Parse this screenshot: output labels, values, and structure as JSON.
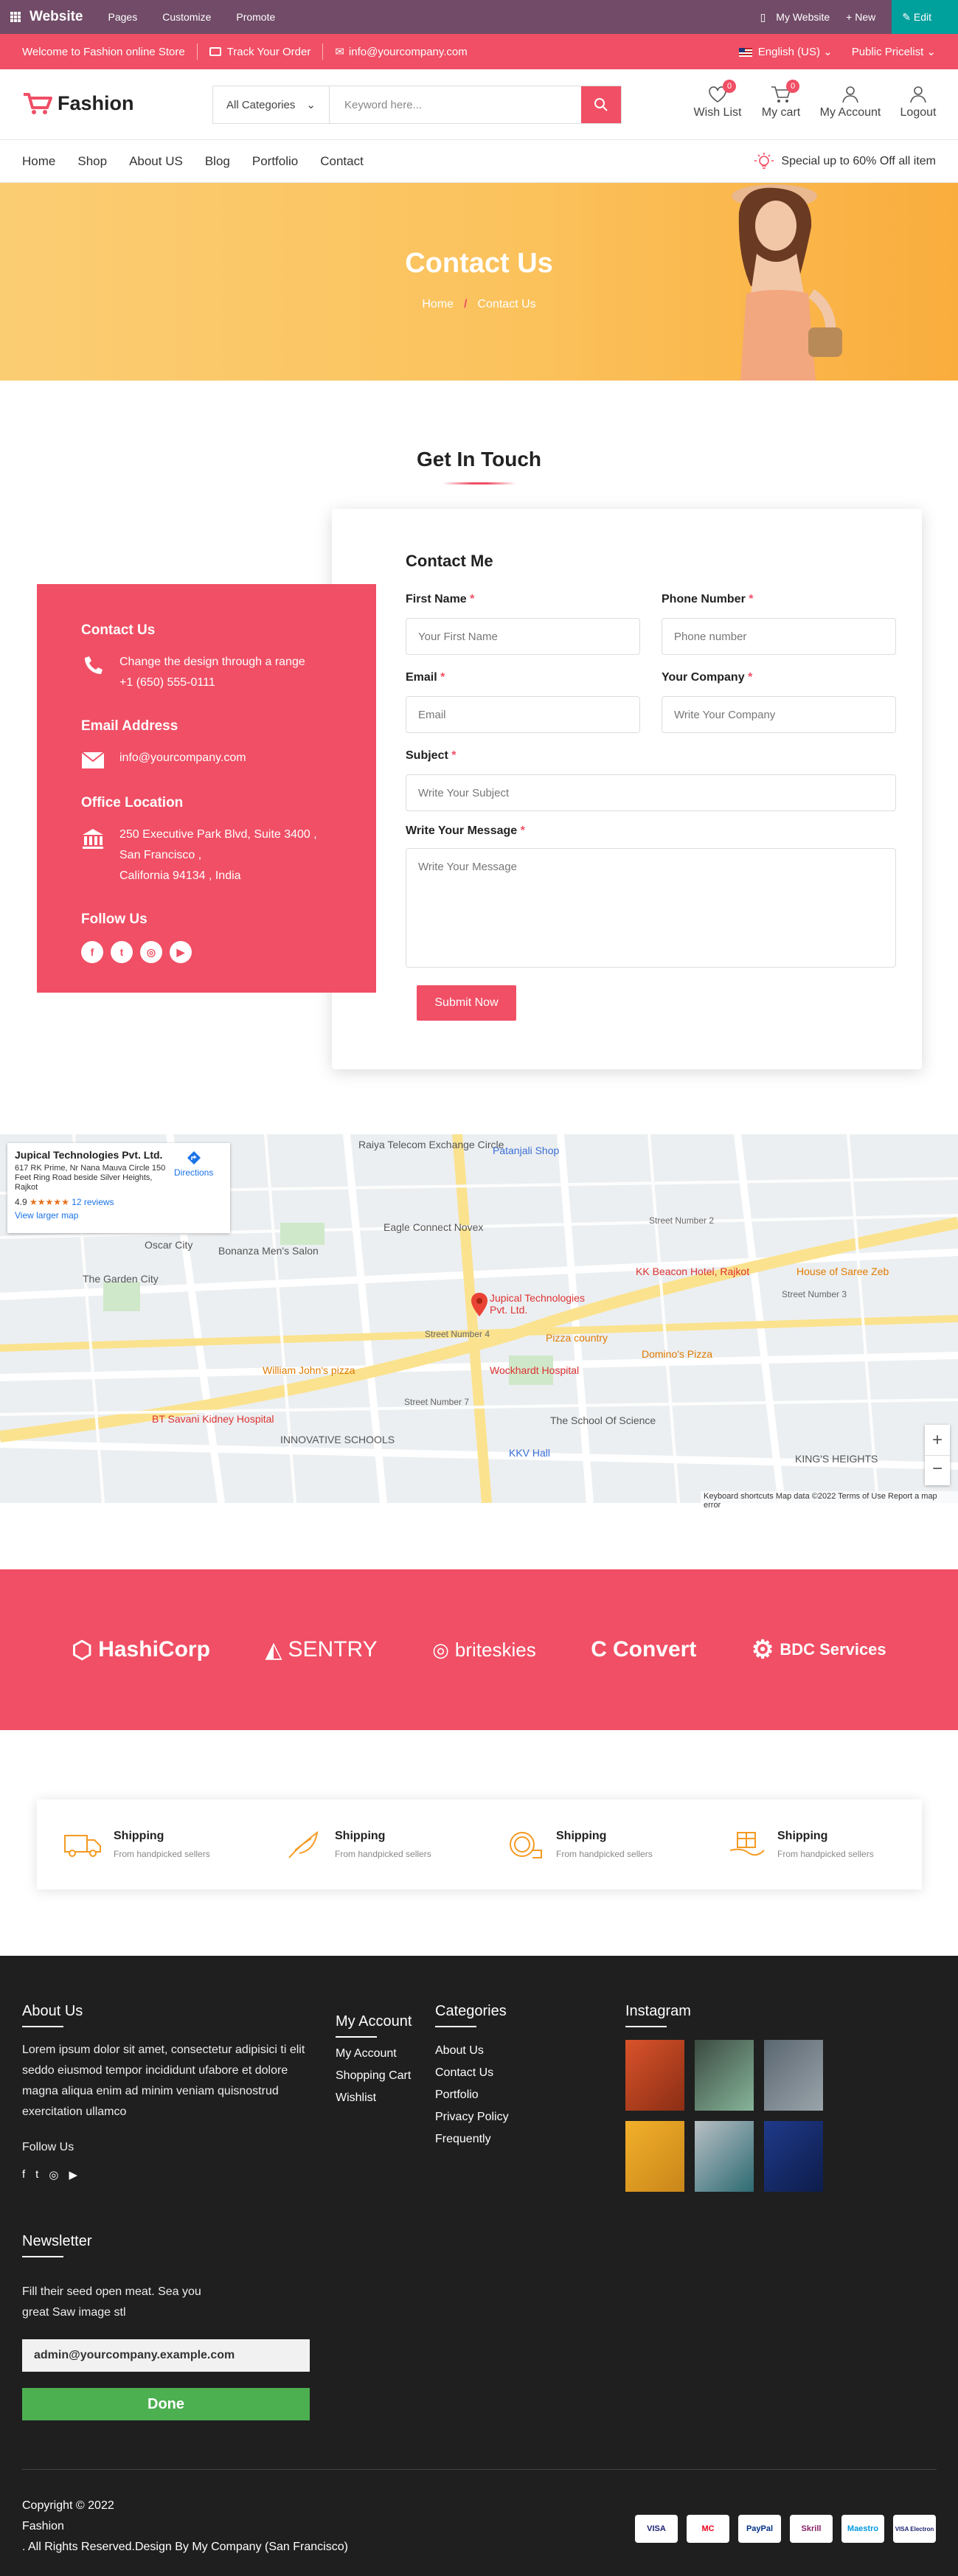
{
  "admin_bar": {
    "brand": "Website",
    "menu": [
      "Pages",
      "Customize",
      "Promote"
    ],
    "my_website": "My Website",
    "new": "+ New",
    "edit": "Edit"
  },
  "top_strip": {
    "welcome": "Welcome to Fashion online Store",
    "track": "Track Your Order",
    "email": "info@yourcompany.com",
    "language": "English (US)",
    "pricelist": "Public Pricelist"
  },
  "header": {
    "logo": "Fashion",
    "search_category": "All Categories",
    "search_placeholder": "Keyword here...",
    "wishlist": "Wish List",
    "wishlist_count": "0",
    "cart": "My cart",
    "cart_count": "0",
    "account": "My Account",
    "logout": "Logout"
  },
  "nav": {
    "items": [
      "Home",
      "Shop",
      "About US",
      "Blog",
      "Portfolio",
      "Contact"
    ],
    "promo": "Special up to 60% Off all item"
  },
  "hero": {
    "title": "Contact Us",
    "crumb_home": "Home",
    "crumb_current": "Contact Us"
  },
  "contact": {
    "heading": "Get In Touch",
    "info": {
      "contact_title": "Contact Us",
      "contact_line1": "Change the design through a range",
      "contact_phone": "+1 (650) 555-0111",
      "email_title": "Email Address",
      "email": "info@yourcompany.com",
      "office_title": "Office Location",
      "address1": "250 Executive Park Blvd, Suite 3400 , San Francisco ,",
      "address2": "California 94134 , India",
      "follow_title": "Follow Us"
    },
    "form": {
      "title": "Contact Me",
      "first_name_label": "First Name",
      "first_name_ph": "Your First Name",
      "phone_label": "Phone Number",
      "phone_ph": "Phone number",
      "email_label": "Email",
      "email_ph": "Email",
      "company_label": "Your Company",
      "company_ph": "Write Your Company",
      "subject_label": "Subject",
      "subject_ph": "Write Your Subject",
      "message_label": "Write Your Message",
      "message_ph": "Write Your Message",
      "required": "*",
      "submit": "Submit Now"
    }
  },
  "map": {
    "place_name": "Jupical Technologies Pvt. Ltd.",
    "place_addr": "617 RK Prime, Nr Nana Mauva Circle 150 Feet Ring Road beside Silver Heights, Rajkot",
    "rating": "4.9",
    "stars": "★★★★★",
    "reviews": "12 reviews",
    "directions": "Directions",
    "larger": "View larger map",
    "pin_label1": "Jupical Technologies",
    "pin_label2": "Pvt. Ltd.",
    "labels": [
      "Raiya Telecom Exchange Circle",
      "Patanjali Shop",
      "Eagle Connect Novex",
      "Oscar City",
      "The Garden City",
      "Bonanza Men's Salon",
      "KK Beacon Hotel, Rajkot",
      "House of Saree Zeb",
      "Wockhardt Hospital",
      "Pizza country",
      "Domino's Pizza",
      "William John's pizza",
      "BT Savani Kidney Hospital",
      "INNOVATIVE SCHOOLS",
      "KKV Hall",
      "The School Of Science",
      "KING'S HEIGHTS",
      "Street Number 2",
      "Street Number 3",
      "Street Number 4",
      "Street Number 7"
    ],
    "footer": "Keyboard shortcuts   Map data ©2022   Terms of Use   Report a map error"
  },
  "brands": [
    "HashiCorp",
    "SENTRY",
    "briteskies",
    "Convert",
    "BDC Services"
  ],
  "shipping": [
    {
      "title": "Shipping",
      "sub": "From handpicked sellers"
    },
    {
      "title": "Shipping",
      "sub": "From handpicked sellers"
    },
    {
      "title": "Shipping",
      "sub": "From handpicked sellers"
    },
    {
      "title": "Shipping",
      "sub": "From handpicked sellers"
    }
  ],
  "footer": {
    "about_title": "About Us",
    "about_text": "Lorem ipsum dolor sit amet, consectetur adipisici ti elit seddo eiusmod tempor incididunt ufabore et dolore magna aliqua enim ad minim veniam quisnostrud exercitation ullamco",
    "follow": "Follow Us",
    "account_title": "My Account",
    "account_links": [
      "My Account",
      "Shopping Cart",
      "Wishlist"
    ],
    "categories_title": "Categories",
    "category_links": [
      "About Us",
      "Contact Us",
      "Portfolio",
      "Privacy Policy",
      "Frequently"
    ],
    "instagram_title": "Instagram",
    "newsletter_title": "Newsletter",
    "newsletter_text": "Fill their seed open meat. Sea you great Saw image stl",
    "newsletter_email": "admin@yourcompany.example.com",
    "newsletter_btn": "Done",
    "copyright1": "Copyright © 2022",
    "copyright2": "Fashion",
    "copyright3": ". All Rights Reserved.Design By My Company (San Francisco)",
    "payments": [
      "VISA",
      "MC",
      "PayPal",
      "Skrill",
      "Maestro",
      "VISA Electron"
    ]
  },
  "colors": {
    "accent": "#f04f65",
    "admin": "#714b67",
    "footer": "#1f1f1f",
    "done": "#4caf50"
  }
}
